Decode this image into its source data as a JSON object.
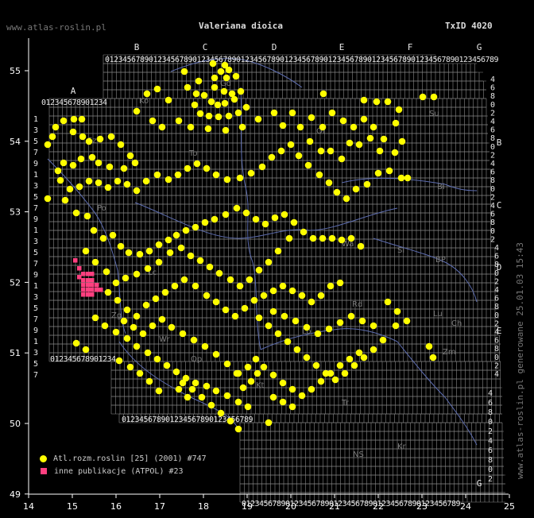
{
  "header": {
    "site": "www.atlas-roslin.pl",
    "title": "Valeriana dioica",
    "taxid": "TxID 4020"
  },
  "watermark": "www.atlas-roslin.pl generowane 25.01.03 15:43",
  "legend": [
    {
      "symbol": "yellow-dot",
      "color": "#ffff00",
      "label": "Atl.rozm.roslin [25] (2001) #747"
    },
    {
      "symbol": "pink-square",
      "color": "#ff3f7f",
      "label": "inne publikacje (ATPOL) #23"
    }
  ],
  "colors": {
    "background": "#000000",
    "grid": "#888888",
    "record": "#ffff00",
    "other_record": "#ff3f7f",
    "river": "#5f6fb0"
  },
  "axes": {
    "x_ticks": [
      "14",
      "15",
      "16",
      "17",
      "18",
      "19",
      "20",
      "21",
      "22",
      "23",
      "24",
      "25"
    ],
    "y_ticks": [
      "55",
      "54",
      "53",
      "52",
      "51",
      "50",
      "49"
    ]
  },
  "atpol": {
    "top_letters": [
      "B",
      "C",
      "D",
      "E",
      "F",
      "G"
    ],
    "left_letter": "A",
    "right_letters": [
      "B",
      "C",
      "D",
      "E"
    ],
    "bottom_right_letter": "G",
    "digits": [
      "0",
      "1",
      "2",
      "3",
      "4",
      "5",
      "6",
      "7",
      "8",
      "9"
    ],
    "right_digits": [
      "4",
      "6",
      "8",
      "0",
      "2",
      "4",
      "6",
      "8",
      "0",
      "2"
    ]
  },
  "region_labels": [
    "Su",
    "Bi",
    "Si",
    "BP",
    "Lu",
    "Ch",
    "Rd",
    "Zm",
    "Kt",
    "Tr",
    "NS",
    "Kr",
    "Lo",
    "Po",
    "Wa",
    "To",
    "Gd",
    "Ko",
    "Sz",
    "Lc",
    "Ol",
    "Zg",
    "Wr",
    "Op"
  ]
}
